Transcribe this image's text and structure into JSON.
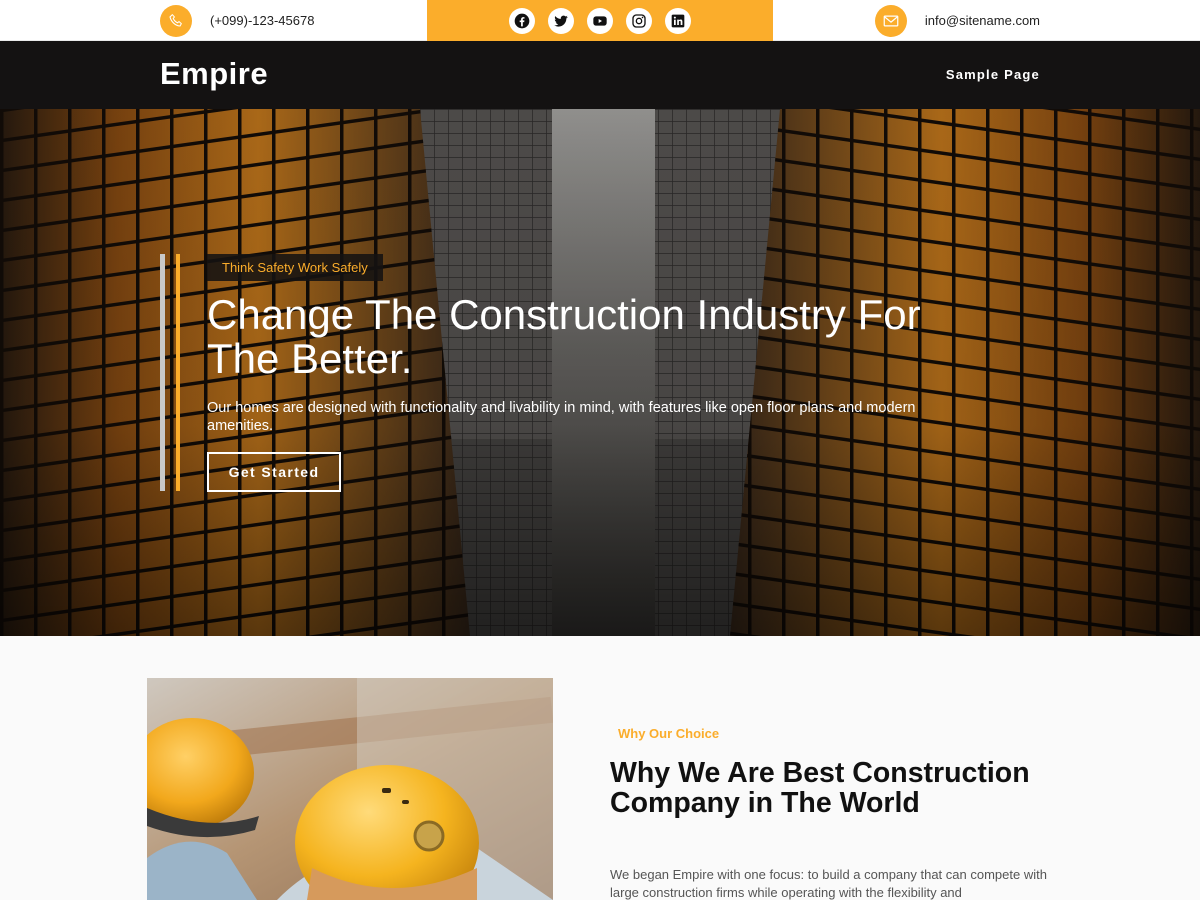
{
  "topbar": {
    "phone": "(+099)-123-45678",
    "email": "info@sitename.com",
    "phone_icon": "phone-icon",
    "email_icon": "envelope-icon",
    "social": [
      "facebook-icon",
      "twitter-icon",
      "youtube-icon",
      "instagram-icon",
      "linkedin-icon"
    ],
    "accent": "#fbad2b"
  },
  "nav": {
    "logo": "Empire",
    "links": [
      "Sample Page"
    ],
    "background": "#141212"
  },
  "hero": {
    "eyebrow": "Think Safety Work Safely",
    "title": "Change The Construction Industry For The Better.",
    "description": "Our homes are designed with functionality and livability in mind, with features like open floor plans and modern amenities.",
    "button": "Get Started"
  },
  "about": {
    "eyebrow": "Why Our Choice",
    "title": "Why We Are Best Construction Company in The World",
    "text": "We began Empire with one focus: to build a company that can compete with large construction firms while operating with the flexibility and"
  }
}
